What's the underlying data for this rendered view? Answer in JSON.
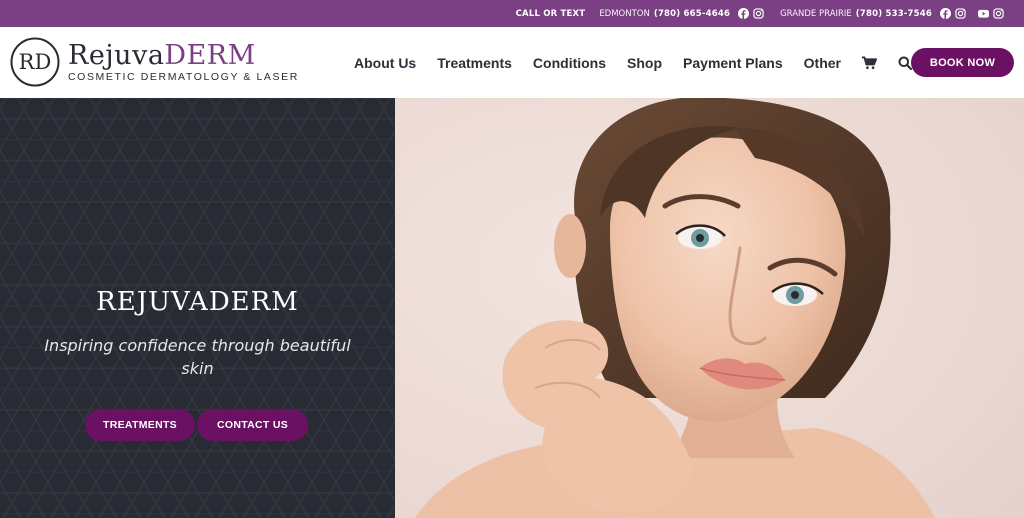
{
  "topbar": {
    "call_label": "CALL OR TEXT",
    "locations": [
      {
        "city": "EDMONTON",
        "phone": "(780) 665-4646",
        "socials": [
          "facebook-icon",
          "instagram-icon"
        ]
      },
      {
        "city": "GRANDE PRAIRIE",
        "phone": "(780) 533-7546",
        "socials": [
          "facebook-icon",
          "instagram-icon"
        ]
      }
    ],
    "extra_socials": [
      "youtube-icon",
      "instagram-icon"
    ],
    "bg_color": "#7b3f84"
  },
  "brand": {
    "monogram": "RD",
    "name_part1": "Rejuva",
    "name_part2": "DERM",
    "tagline": "COSMETIC DERMATOLOGY & LASER",
    "accent_color": "#7b3f84"
  },
  "nav": {
    "items": [
      "About Us",
      "Treatments",
      "Conditions",
      "Shop",
      "Payment Plans",
      "Other"
    ],
    "icons": [
      "cart-icon",
      "search-icon"
    ],
    "book_label": "BOOK NOW",
    "button_color": "#6b1164"
  },
  "hero": {
    "title": "REJUVADERM",
    "subtitle": "Inspiring confidence through beautiful skin",
    "buttons": [
      "TREATMENTS",
      "CONTACT US"
    ],
    "panel_color": "#292b34",
    "image": "portrait-photo"
  }
}
